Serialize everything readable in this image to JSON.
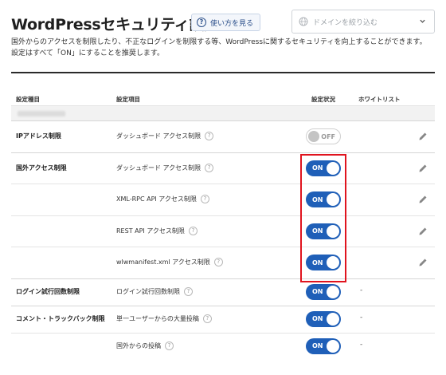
{
  "header": {
    "title": "WordPressセキュリティ設定",
    "howto_label": "使い方を見る",
    "domain_placeholder": "ドメインを絞り込む"
  },
  "description": {
    "line1": "国外からのアクセスを制限したり、不正なログインを制限する等、WordPressに関するセキュリティを向上することができます。",
    "line2": "設定はすべて「ON」にすることを推奨します。"
  },
  "table": {
    "columns": {
      "category": "設定種目",
      "item": "設定項目",
      "status": "設定状況",
      "whitelist": "ホワイトリスト"
    },
    "rows": [
      {
        "category": "IPアドレス制限",
        "item": "ダッシュボード アクセス制限",
        "state": "OFF"
      },
      {
        "category": "国外アクセス制限",
        "item": "ダッシュボード アクセス制限",
        "state": "ON"
      },
      {
        "category": "",
        "item": "XML-RPC API アクセス制限",
        "state": "ON"
      },
      {
        "category": "",
        "item": "REST API アクセス制限",
        "state": "ON"
      },
      {
        "category": "",
        "item": "wlwmanifest.xml アクセス制限",
        "state": "ON"
      },
      {
        "category": "ログイン試行回数制限",
        "item": "ログイン試行回数制限",
        "state": "ON",
        "whitelist": "-"
      },
      {
        "category": "コメント・トラックバック制限",
        "item": "単一ユーザーからの大量投稿",
        "state": "ON",
        "whitelist": "-"
      },
      {
        "category": "",
        "item": "国外からの投稿",
        "state": "ON",
        "whitelist": "-"
      }
    ]
  },
  "colors": {
    "toggle_on": "#1f5fb8",
    "highlight": "#e0141e"
  }
}
